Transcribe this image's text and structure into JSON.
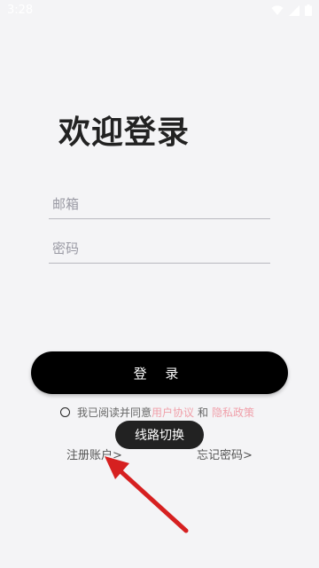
{
  "status_bar": {
    "time": "3:28",
    "icons": [
      "wifi-icon",
      "signal-icon",
      "battery-icon"
    ],
    "color": "#ffffff"
  },
  "title": "欢迎登录",
  "email_field": {
    "placeholder": "邮箱",
    "value": ""
  },
  "password_field": {
    "placeholder": "密码",
    "value": ""
  },
  "login_button": {
    "label": "登 录",
    "background": "#000000"
  },
  "agreement": {
    "prefix": "我已阅读并同意",
    "user_agreement": "用户协议",
    "and": "和",
    "privacy_policy": "隐私政策",
    "link_color": "#f0a0aa"
  },
  "links": {
    "register": "注册账户>",
    "forgot": "忘记密码>"
  },
  "toast": {
    "text": "线路切换"
  },
  "annotation_arrow": {
    "color": "#d62020"
  }
}
